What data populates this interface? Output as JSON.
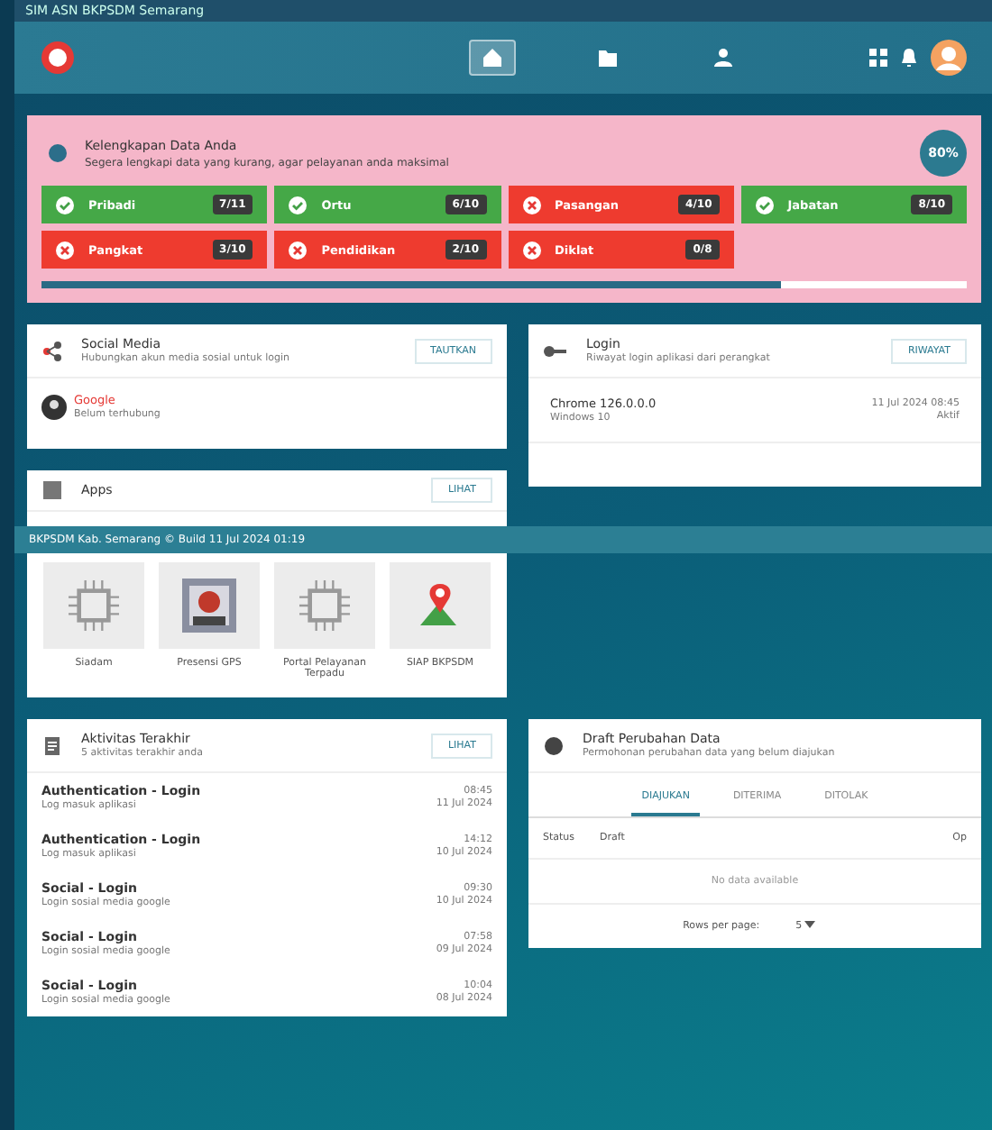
{
  "top_bar": {
    "title": "SIM ASN BKPSDM Semarang"
  },
  "nav": [
    {
      "kind": "home",
      "selected": true
    },
    {
      "kind": "folder",
      "selected": false
    },
    {
      "kind": "person",
      "selected": false
    }
  ],
  "completeness": {
    "title": "Kelengkapan Data Anda",
    "subtitle": "Segera lengkapi data yang kurang, agar pelayanan anda maksimal",
    "percent": "80%",
    "level": 0.8,
    "tiles": [
      {
        "label": "Pribadi",
        "count": "7/11",
        "complete": true
      },
      {
        "label": "Ortu",
        "count": "6/10",
        "complete": true
      },
      {
        "label": "Pasangan",
        "count": "4/10",
        "complete": false
      },
      {
        "label": "Jabatan",
        "count": "8/10",
        "complete": true
      },
      {
        "label": "Pangkat",
        "count": "3/10",
        "complete": false
      },
      {
        "label": "Pendidikan",
        "count": "2/10",
        "complete": false
      },
      {
        "label": "Diklat",
        "count": "0/8",
        "complete": false
      }
    ]
  },
  "social": {
    "title": "Social Media",
    "subtitle": "Hubungkan akun media sosial untuk login",
    "button": "TAUTKAN",
    "items": [
      {
        "name": "Google",
        "status": "Belum terhubung"
      }
    ]
  },
  "login": {
    "title": "Login",
    "subtitle": "Riwayat login aplikasi dari perangkat",
    "button": "RIWAYAT",
    "items": [
      {
        "browser": "Chrome 126.0.0.0",
        "os": "Windows 10",
        "time": "11 Jul 2024 08:45",
        "status": "Aktif"
      }
    ]
  },
  "apps": {
    "title": "Apps",
    "button": "LIHAT",
    "items": [
      {
        "label": "Siadam",
        "kind": "chip"
      },
      {
        "label": "Presensi GPS"
      },
      {
        "label": "Portal Pelayanan Terpadu",
        "kind": "chip"
      },
      {
        "label": "SIAP BKPSDM",
        "kind": "map"
      }
    ]
  },
  "status_bar": {
    "text": "BKPSDM Kab. Semarang © Build 11 Jul 2024 01:19"
  },
  "activity": {
    "title": "Aktivitas Terakhir",
    "subtitle": "5 aktivitas terakhir anda",
    "button": "LIHAT",
    "items": [
      {
        "title": "Authentication - Login",
        "detail": "Log masuk aplikasi",
        "time": "08:45",
        "date": "11 Jul 2024"
      },
      {
        "title": "Authentication - Login",
        "detail": "Log masuk aplikasi",
        "time": "14:12",
        "date": "10 Jul 2024"
      },
      {
        "title": "Social - Login",
        "detail": "Login sosial media google",
        "time": "09:30",
        "date": "10 Jul 2024"
      },
      {
        "title": "Social - Login",
        "detail": "Login sosial media google",
        "time": "07:58",
        "date": "09 Jul 2024"
      },
      {
        "title": "Social - Login",
        "detail": "Login sosial media google",
        "time": "10:04",
        "date": "08 Jul 2024"
      }
    ]
  },
  "draft": {
    "title": "Draft Perubahan Data",
    "subtitle": "Permohonan perubahan data yang belum diajukan",
    "tabs": [
      {
        "label": "DIAJUKAN",
        "selected": true
      },
      {
        "label": "DITERIMA",
        "selected": false
      },
      {
        "label": "DITOLAK",
        "selected": false
      }
    ],
    "columns": [
      "Status",
      "Draft",
      "Op"
    ],
    "empty": "No data available",
    "rows_per_page": "Rows per page:",
    "page_size": "5"
  }
}
